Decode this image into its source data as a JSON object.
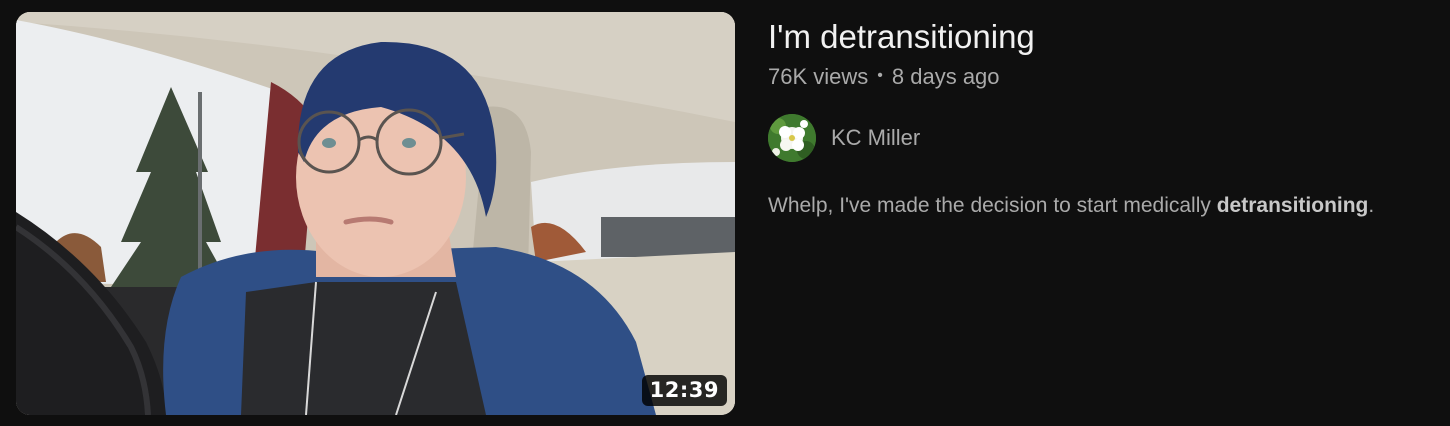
{
  "video": {
    "title": "I'm detransitioning",
    "views": "76K views",
    "separator": "•",
    "age": "8 days ago",
    "duration": "12:39",
    "channel": {
      "name": "KC Miller",
      "avatar_icon": "flower-avatar-icon"
    },
    "snippet": {
      "text_before": "Whelp, I've made the decision to start medically ",
      "highlight": "detransitioning",
      "text_after": "."
    },
    "thumbnail_description_icon": "video-thumbnail-image"
  },
  "colors": {
    "background": "#0f0f0f",
    "title": "#f1f1f1",
    "secondary_text": "#aaaaaa",
    "duration_badge": "#000000"
  }
}
